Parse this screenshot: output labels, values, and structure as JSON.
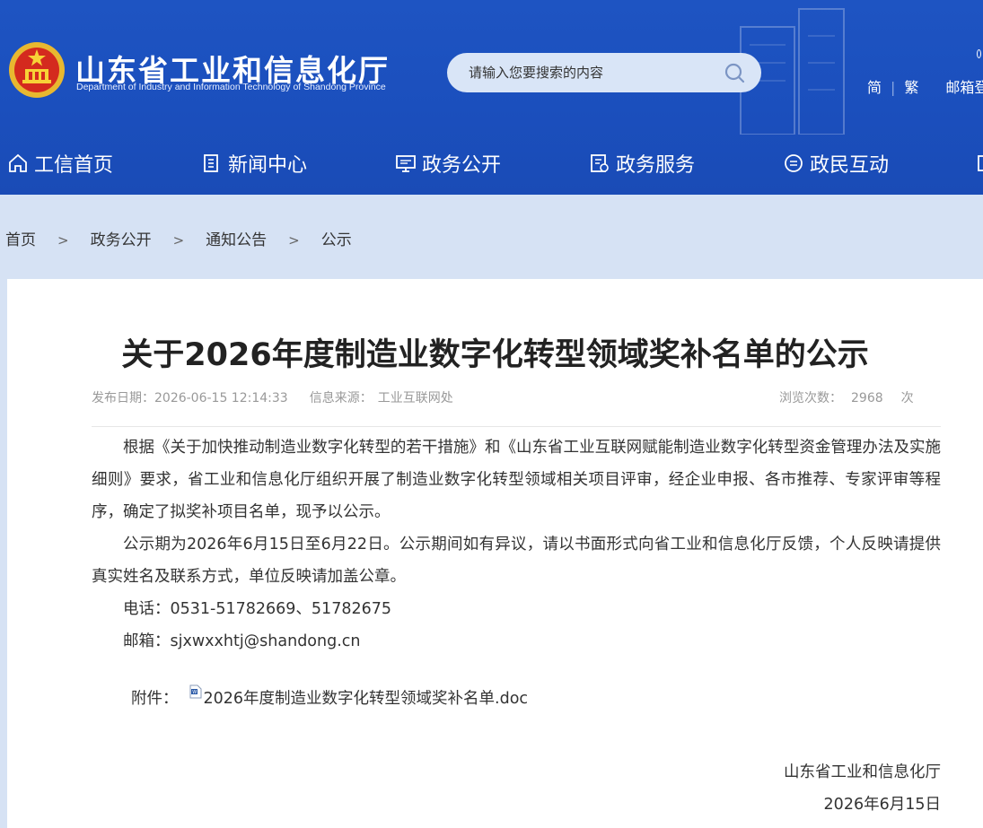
{
  "header": {
    "site_name": "山东省工业和信息化厅",
    "site_subtitle": "Department of Industry and Information Technology of Shandong Province",
    "search_placeholder": "请输入您要搜索的内容",
    "links": {
      "simplified": "简",
      "traditional": "繁",
      "mail": "邮箱登"
    },
    "colors": {
      "header_blue": "#1b4fbd",
      "search_bg": "#d9e5f7"
    }
  },
  "nav": [
    {
      "label": "工信首页",
      "icon": "home-icon"
    },
    {
      "label": "新闻中心",
      "icon": "news-icon"
    },
    {
      "label": "政务公开",
      "icon": "monitor-icon"
    },
    {
      "label": "政务服务",
      "icon": "service-icon"
    },
    {
      "label": "政民互动",
      "icon": "chat-icon"
    }
  ],
  "breadcrumb": [
    "首页",
    "政务公开",
    "通知公告",
    "公示"
  ],
  "article": {
    "title": "关于2026年度制造业数字化转型领域奖补名单的公示",
    "publish_label": "发布日期：",
    "publish_date": "2026-06-15 12:14:33",
    "source_label": "信息来源：",
    "source": "工业互联网处",
    "views_label": "浏览次数：",
    "views": "2968",
    "views_unit": "次",
    "paragraph1": "根据《关于加快推动制造业数字化转型的若干措施》和《山东省工业互联网赋能制造业数字化转型资金管理办法及实施细则》要求，省工业和信息化厅组织开展了制造业数字化转型领域相关项目评审，经企业申报、各市推荐、专家评审等程序，确定了拟奖补项目名单，现予以公示。",
    "paragraph2": "公示期为2026年6月15日至6月22日。公示期间如有异议，请以书面形式向省工业和信息化厅反馈，个人反映请提供真实姓名及联系方式，单位反映请加盖公章。",
    "phone": "电话：0531-51782669、51782675",
    "email": "邮箱：sjxwxxhtj@shandong.cn",
    "attachment_label": "附件：",
    "attachment_name": "2026年度制造业数字化转型领域奖补名单.doc",
    "sign_org": "山东省工业和信息化厅",
    "sign_date": "2026年6月15日"
  }
}
